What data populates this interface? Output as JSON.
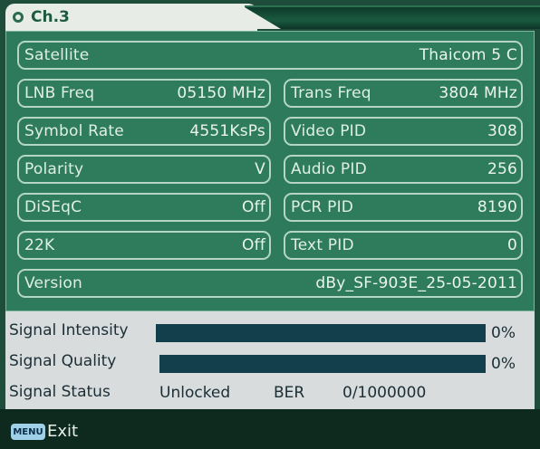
{
  "header": {
    "channel": "Ch.3"
  },
  "fields": {
    "satellite": {
      "label": "Satellite",
      "value": "Thaicom 5 C"
    },
    "lnb_freq": {
      "label": "LNB Freq",
      "value": "05150 MHz"
    },
    "trans_freq": {
      "label": "Trans Freq",
      "value": "3804 MHz"
    },
    "symbol_rate": {
      "label": "Symbol Rate",
      "value": "4551KsPs"
    },
    "video_pid": {
      "label": "Video PID",
      "value": "308"
    },
    "polarity": {
      "label": "Polarity",
      "value": "V"
    },
    "audio_pid": {
      "label": "Audio PID",
      "value": "256"
    },
    "diseqc": {
      "label": "DiSEqC",
      "value": "Off"
    },
    "pcr_pid": {
      "label": "PCR PID",
      "value": "8190"
    },
    "k22": {
      "label": "22K",
      "value": "Off"
    },
    "text_pid": {
      "label": "Text PID",
      "value": "0"
    },
    "version": {
      "label": "Version",
      "value": "dBy_SF-903E_25-05-2011"
    }
  },
  "signal": {
    "intensity": {
      "label": "Signal Intensity",
      "percent": "0%"
    },
    "quality": {
      "label": "Signal Quality",
      "percent": "0%"
    },
    "status": {
      "label": "Signal Status",
      "value": "Unlocked",
      "ber_label": "BER",
      "ber_value": "0/1000000"
    }
  },
  "footer": {
    "menu_key": "MENU",
    "exit_label": "Exit"
  },
  "colors": {
    "panel": "#2e7a5c",
    "field_border": "#b5d6c6",
    "signal_bg": "#d8dcdd",
    "bar": "#133e4c",
    "footer": "#0e2a1f"
  }
}
